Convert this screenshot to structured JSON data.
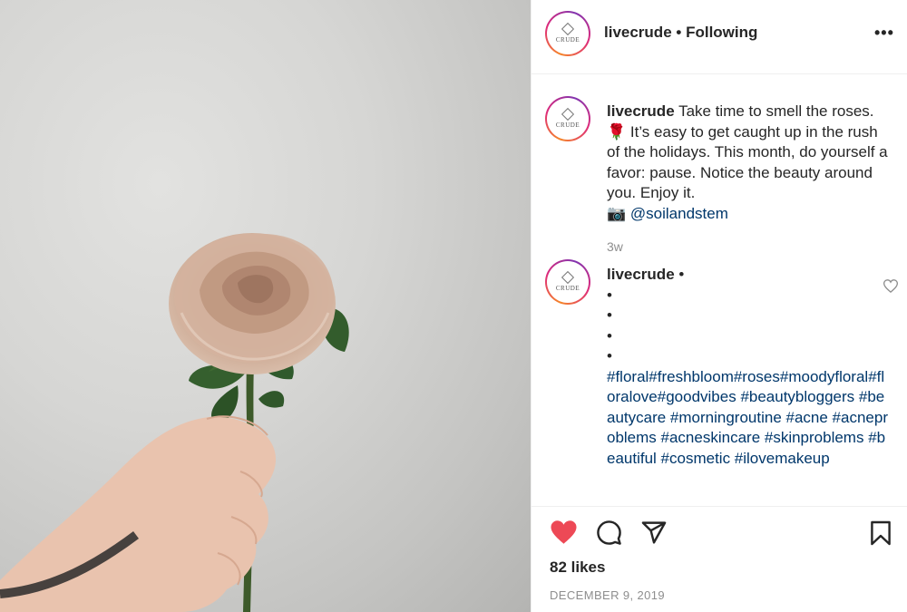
{
  "post": {
    "author": "livecrude",
    "separator": "•",
    "follow_status": "Following",
    "more_icon": "more-horizontal-icon",
    "avatar_text": "CRUDE"
  },
  "caption": {
    "user": "livecrude",
    "text": "Take time to smell the roses. 🌹 It’s easy to get caught up in the rush of the holidays. This month, do yourself a favor: pause. Notice the beauty around you. Enjoy it.",
    "camera_emoji": "📷",
    "mention": "@soilandstem",
    "time": "3w"
  },
  "comment": {
    "user": "livecrude",
    "suffix": "•",
    "bullets": [
      "•",
      "•",
      "•",
      "•"
    ],
    "hashtags": "#floral#freshbloom#roses#moodyfloral#floralove#goodvibes #beautybloggers #beautycare #morningroutine #acne #acneproblems #acneskincare #skinproblems #beautiful #cosmetic #ilovemakeup",
    "like_icon": "heart-outline-icon"
  },
  "actions": {
    "like_icon": "heart-filled-icon",
    "comment_icon": "comment-icon",
    "share_icon": "share-icon",
    "save_icon": "bookmark-icon",
    "like_color": "#ed4956",
    "likes": "82 likes",
    "date": "DECEMBER 9, 2019"
  }
}
